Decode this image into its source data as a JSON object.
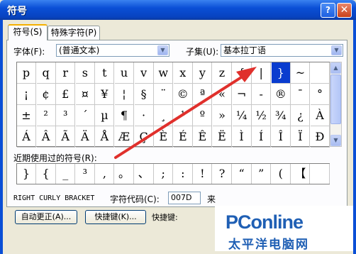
{
  "window": {
    "title": "符号",
    "help": "?",
    "close": "✕"
  },
  "tabs": [
    {
      "label": "符号(S)",
      "active": true
    },
    {
      "label": "特殊字符(P)",
      "active": false
    }
  ],
  "font": {
    "label": "字体(F):",
    "value": "(普通文本)"
  },
  "subset": {
    "label": "子集(U):",
    "value": "基本拉丁语"
  },
  "grid": {
    "rows": [
      [
        "p",
        "q",
        "r",
        "s",
        "t",
        "u",
        "v",
        "w",
        "x",
        "y",
        "z",
        "{",
        "|",
        "}",
        "~",
        ""
      ],
      [
        "¡",
        "¢",
        "£",
        "¤",
        "¥",
        "¦",
        "§",
        "¨",
        "©",
        "ª",
        "«",
        "¬",
        "-",
        "®",
        "¯",
        "°"
      ],
      [
        "±",
        "²",
        "³",
        "´",
        "µ",
        "¶",
        "·",
        "¸",
        "¹",
        "º",
        "»",
        "¼",
        "½",
        "¾",
        "¿",
        "À"
      ],
      [
        "Á",
        "Â",
        "Ã",
        "Ä",
        "Å",
        "Æ",
        "Ç",
        "È",
        "É",
        "Ê",
        "Ë",
        "Ì",
        "Í",
        "Î",
        "Ï",
        "Ð"
      ]
    ],
    "selected": {
      "row": 0,
      "col": 13
    }
  },
  "recent": {
    "label": "近期使用过的符号(R):",
    "symbols": [
      "}",
      "{",
      "_",
      "³",
      ",",
      "。",
      "、",
      ";",
      ":",
      "!",
      "?",
      "“",
      "”",
      "(",
      "【",
      ""
    ]
  },
  "char_name": "RIGHT CURLY BRACKET",
  "char_code": {
    "label": "字符代码(C):",
    "value": "007D"
  },
  "from": {
    "label": "来"
  },
  "buttons": {
    "autocorrect": "自动更正(A)...",
    "shortcut_key": "快捷键(K)...",
    "shortcut_label": "快捷键:"
  },
  "watermark": {
    "brand": "PConline",
    "tagline": "太平洋电脑网"
  },
  "colors": {
    "titlebar": "#0a4fd6",
    "selection": "#0a3ccf",
    "arrow": "#e0302c",
    "logo": "#1f5fb4"
  },
  "icons": {
    "dropdown": "chevron-down-icon",
    "scroll_up": "chevron-up-icon",
    "scroll_down": "chevron-down-icon"
  }
}
